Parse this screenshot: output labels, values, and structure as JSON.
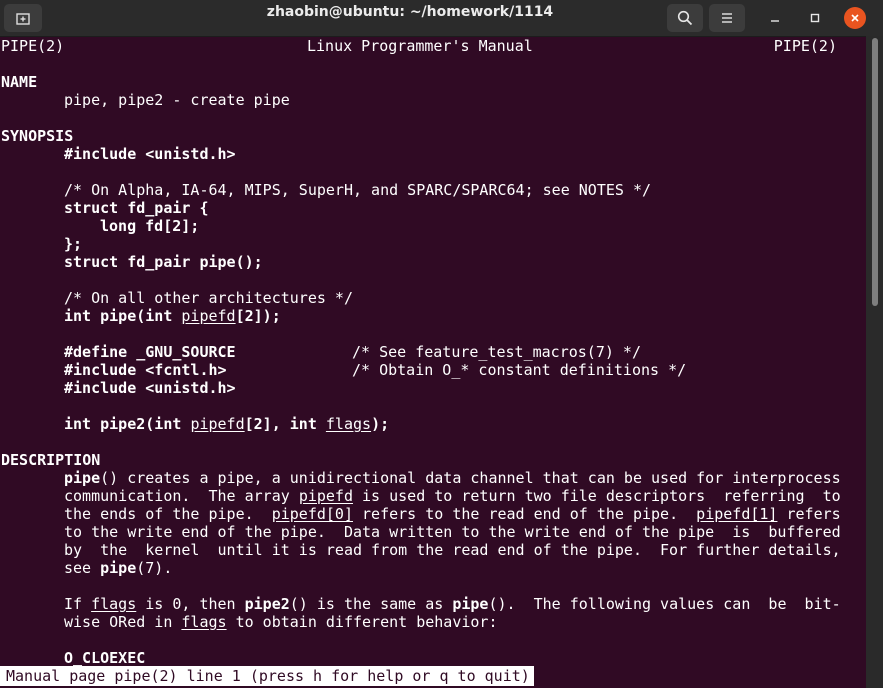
{
  "window": {
    "title": "zhaobin@ubuntu: ~/homework/1114",
    "buttons": [
      "new-tab",
      "search",
      "menu",
      "minimize",
      "maximize",
      "close"
    ]
  },
  "man": {
    "header_left": "PIPE(2)",
    "header_center": "Linux Programmer's Manual",
    "header_right": "PIPE(2)",
    "name_heading": "NAME",
    "name_text": "pipe, pipe2 - create pipe",
    "synopsis_heading": "SYNOPSIS",
    "include_unistd": "#include <unistd.h>",
    "comment_alpha": "/* On Alpha, IA-64, MIPS, SuperH, and SPARC/SPARC64; see NOTES */",
    "struct_open": "struct fd_pair {",
    "struct_member": "long fd[2];",
    "struct_close": "};",
    "struct_decl": "struct fd_pair pipe();",
    "comment_other": "/* On all other architectures */",
    "pipe_decl_pre": "int pipe(int ",
    "pipe_decl_arg": "pipefd",
    "pipe_decl_post": "[2]);",
    "define_gnu": "#define _GNU_SOURCE",
    "define_comment": "/* See feature_test_macros(7) */",
    "include_fcntl": "#include <fcntl.h>",
    "fcntl_comment": "/* Obtain O_* constant definitions */",
    "include_unistd2": "#include <unistd.h>",
    "pipe2_decl_pre": "int pipe2(int ",
    "pipe2_decl_arg1": "pipefd",
    "pipe2_decl_mid": "[2], int ",
    "pipe2_decl_arg2": "flags",
    "pipe2_decl_post": ");",
    "description_heading": "DESCRIPTION",
    "d1_bold": "pipe",
    "d1_rest": "() creates a pipe, a unidirectional data channel that can be used for interprocess",
    "d2_pre": "communication.  The array ",
    "d2_u": "pipefd",
    "d2_post": " is used to return two file descriptors  referring  to",
    "d3_pre": "the ends of the pipe.  ",
    "d3_u1": "pipefd[0]",
    "d3_mid": " refers to the read end of the pipe.  ",
    "d3_u2": "pipefd[1]",
    "d3_post": " refers",
    "d4": "to the write end of the pipe.  Data written to the write end of the pipe  is  buffered",
    "d5": "by  the  kernel  until it is read from the read end of the pipe.  For further details,",
    "d6_pre": "see ",
    "d6_bold": "pipe",
    "d6_post": "(7).",
    "f1_pre": "If ",
    "f1_u": "flags",
    "f1_mid1": " is 0, then ",
    "f1_b1": "pipe2",
    "f1_mid2": "() is the same as ",
    "f1_b2": "pipe",
    "f1_post": "().  The following values can  be  bit-",
    "f2_pre": "wise ORed in ",
    "f2_u": "flags",
    "f2_post": " to obtain different behavior:",
    "cloexec": "O_CLOEXEC"
  },
  "status_line": "Manual page pipe(2) line 1 (press h for help or q to quit)",
  "colors": {
    "background": "#300a24",
    "titlebar": "#2b2b2b",
    "close_button": "#e95420",
    "text": "#ffffff"
  }
}
